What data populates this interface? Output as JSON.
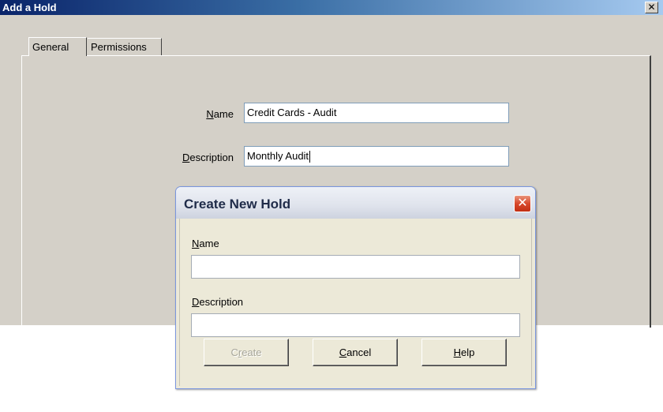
{
  "window": {
    "title": "Add a Hold",
    "close_glyph": "✕"
  },
  "tabs": [
    {
      "label": "General",
      "selected": true
    },
    {
      "label": "Permissions",
      "selected": false
    }
  ],
  "form": {
    "name_label_first": "N",
    "name_label_rest": "ame",
    "name_value": "Credit Cards - Audit",
    "description_label_first": "D",
    "description_label_rest": "escription",
    "description_value": "Monthly Audit"
  },
  "dialog": {
    "title": "Create New Hold",
    "close_glyph": "✕",
    "name_label_first": "N",
    "name_label_rest": "ame",
    "name_value": "",
    "description_label_first": "D",
    "description_label_rest": "escription",
    "description_value": "",
    "buttons": {
      "create_pre": "C",
      "create_key": "r",
      "create_post": "eate",
      "create_enabled": false,
      "cancel_key": "C",
      "cancel_post": "ancel",
      "help_key": "H",
      "help_post": "elp"
    }
  },
  "colors": {
    "titlebar_start": "#0a246a",
    "window_face": "#d4d0c8",
    "xp_close": "#d8482b"
  },
  "icons": {
    "window_close": "close-icon",
    "dialog_close": "close-icon"
  }
}
